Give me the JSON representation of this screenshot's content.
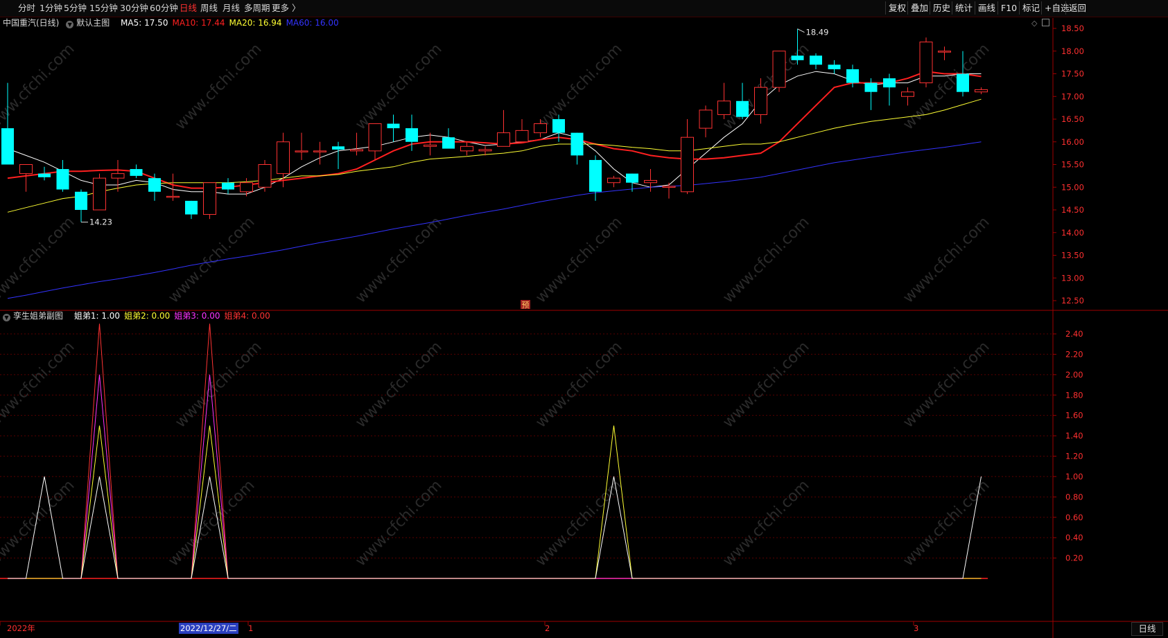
{
  "toolbar": {
    "periods": [
      "分时",
      "1分钟",
      "5分钟",
      "15分钟",
      "30分钟",
      "60分钟",
      "日线",
      "周线",
      "月线",
      "多周期",
      "更多 〉"
    ],
    "active": "日线",
    "right_buttons": [
      "复权",
      "叠加",
      "历史",
      "统计",
      "画线",
      "F10",
      "标记",
      "+自选",
      "返回"
    ]
  },
  "main_panel": {
    "title": "中国重汽(日线)",
    "template": "默认主图",
    "ma": [
      {
        "label": "MA5: 17.50",
        "color": "#ffffff"
      },
      {
        "label": "MA10: 17.44",
        "color": "#ff2020"
      },
      {
        "label": "MA20: 16.94",
        "color": "#ffff33"
      },
      {
        "label": "MA60: 16.00",
        "color": "#3333ff"
      }
    ],
    "high_label": "18.49",
    "low_label": "14.23",
    "pre_marker": "预",
    "y_ticks": [
      "18.50",
      "18.00",
      "17.50",
      "17.00",
      "16.50",
      "16.00",
      "15.50",
      "15.00",
      "14.50",
      "14.00",
      "13.50",
      "13.00",
      "12.50"
    ]
  },
  "sub_panel": {
    "title": "孪生姐弟副图",
    "lines": [
      {
        "label": "姐弟1: 1.00",
        "color": "#ffffff"
      },
      {
        "label": "姐弟2: 0.00",
        "color": "#ffff33"
      },
      {
        "label": "姐弟3: 0.00",
        "color": "#ff33ff"
      },
      {
        "label": "姐弟4: 0.00",
        "color": "#ff3333"
      }
    ],
    "y_ticks": [
      "2.40",
      "2.20",
      "2.00",
      "1.80",
      "1.60",
      "1.40",
      "1.20",
      "1.00",
      "0.80",
      "0.60",
      "0.40",
      "0.20"
    ]
  },
  "bottom_axis": {
    "start": "2022年",
    "cursor_date": "2022/12/27/二",
    "month_1": "1",
    "month_2": "2",
    "month_3": "3",
    "mode_button": "日线"
  },
  "watermark": "www.cfchi.com",
  "chart_data": [
    {
      "type": "candlestick",
      "title": "中国重汽(日线)",
      "ylim": [
        12.4,
        18.6
      ],
      "candles": [
        [
          16.3,
          17.3,
          15.5,
          15.5
        ],
        [
          15.3,
          15.5,
          14.9,
          15.5
        ],
        [
          15.3,
          15.45,
          15.15,
          15.22
        ],
        [
          15.4,
          15.6,
          14.9,
          14.95
        ],
        [
          14.9,
          14.95,
          14.23,
          14.5
        ],
        [
          14.5,
          15.3,
          14.5,
          15.2
        ],
        [
          15.2,
          15.6,
          14.9,
          15.3
        ],
        [
          15.4,
          15.5,
          15.2,
          15.25
        ],
        [
          15.2,
          15.3,
          14.7,
          14.9
        ],
        [
          14.8,
          15.3,
          14.7,
          14.8
        ],
        [
          14.7,
          14.7,
          14.3,
          14.4
        ],
        [
          14.4,
          15.1,
          14.3,
          15.1
        ],
        [
          15.1,
          15.2,
          14.85,
          14.95
        ],
        [
          14.9,
          15.2,
          14.8,
          15.1
        ],
        [
          15.0,
          15.6,
          14.9,
          15.5
        ],
        [
          15.3,
          16.2,
          15.0,
          16.0
        ],
        [
          15.8,
          16.2,
          15.6,
          15.8
        ],
        [
          15.8,
          16.0,
          15.5,
          15.8
        ],
        [
          15.9,
          16.0,
          15.4,
          15.83
        ],
        [
          15.8,
          16.2,
          15.7,
          15.83
        ],
        [
          15.8,
          16.4,
          15.6,
          16.4
        ],
        [
          16.4,
          16.6,
          16.0,
          16.3
        ],
        [
          16.3,
          16.6,
          15.8,
          16.0
        ],
        [
          15.9,
          16.2,
          15.7,
          15.93
        ],
        [
          16.1,
          16.3,
          15.9,
          15.85
        ],
        [
          15.8,
          16.0,
          15.7,
          15.9
        ],
        [
          15.8,
          15.9,
          15.7,
          15.83
        ],
        [
          15.9,
          16.7,
          15.9,
          16.2
        ],
        [
          16.0,
          16.5,
          16.0,
          16.25
        ],
        [
          16.2,
          16.5,
          16.1,
          16.4
        ],
        [
          16.5,
          16.6,
          16.0,
          16.2
        ],
        [
          16.2,
          16.2,
          15.5,
          15.7
        ],
        [
          15.6,
          15.7,
          14.7,
          14.9
        ],
        [
          15.1,
          15.25,
          15.0,
          15.2
        ],
        [
          15.3,
          15.3,
          14.9,
          15.1
        ],
        [
          15.1,
          15.4,
          14.9,
          15.15
        ],
        [
          15.0,
          15.1,
          14.75,
          15.02
        ],
        [
          14.9,
          16.5,
          14.85,
          16.1
        ],
        [
          16.3,
          16.8,
          16.1,
          16.7
        ],
        [
          16.6,
          17.3,
          16.5,
          16.9
        ],
        [
          16.9,
          17.3,
          16.5,
          16.55
        ],
        [
          16.6,
          17.4,
          16.4,
          17.2
        ],
        [
          17.2,
          18.0,
          17.1,
          18.0
        ],
        [
          17.9,
          18.49,
          17.7,
          17.8
        ],
        [
          17.9,
          17.95,
          17.6,
          17.7
        ],
        [
          17.7,
          17.8,
          17.5,
          17.6
        ],
        [
          17.6,
          17.7,
          17.2,
          17.3
        ],
        [
          17.3,
          17.4,
          16.7,
          17.1
        ],
        [
          17.4,
          17.5,
          16.8,
          17.2
        ],
        [
          17.0,
          17.2,
          16.8,
          17.1
        ],
        [
          17.3,
          18.3,
          17.2,
          18.2
        ],
        [
          18.0,
          18.1,
          17.8,
          18.0
        ],
        [
          17.5,
          18.0,
          17.0,
          17.1
        ],
        [
          17.1,
          17.2,
          17.05,
          17.15
        ]
      ],
      "series": [
        {
          "name": "MA5",
          "values": [
            15.85,
            15.7,
            15.55,
            15.35,
            15.15,
            15.05,
            15.05,
            15.15,
            15.1,
            14.95,
            14.9,
            14.9,
            14.85,
            14.85,
            15.0,
            15.2,
            15.45,
            15.65,
            15.8,
            15.85,
            15.9,
            16.0,
            16.1,
            16.15,
            16.1,
            16.0,
            15.92,
            15.95,
            16.0,
            16.05,
            16.2,
            16.1,
            15.8,
            15.4,
            15.1,
            15.0,
            15.05,
            15.4,
            15.75,
            16.1,
            16.4,
            16.9,
            17.25,
            17.45,
            17.55,
            17.5,
            17.35,
            17.25,
            17.3,
            17.3,
            17.45,
            17.45,
            17.5,
            17.5
          ]
        },
        {
          "name": "MA10",
          "values": [
            15.2,
            15.25,
            15.3,
            15.35,
            15.35,
            15.37,
            15.38,
            15.35,
            15.2,
            15.05,
            14.98,
            14.98,
            15.0,
            15.05,
            15.1,
            15.15,
            15.2,
            15.25,
            15.3,
            15.4,
            15.6,
            15.8,
            15.95,
            16.0,
            16.0,
            16.0,
            15.98,
            15.95,
            15.98,
            16.05,
            16.1,
            16.05,
            15.95,
            15.85,
            15.8,
            15.7,
            15.65,
            15.62,
            15.62,
            15.65,
            15.7,
            15.75,
            16.0,
            16.4,
            16.8,
            17.2,
            17.3,
            17.3,
            17.3,
            17.4,
            17.55,
            17.5,
            17.5,
            17.44
          ]
        },
        {
          "name": "MA20",
          "values": [
            14.45,
            14.55,
            14.65,
            14.75,
            14.8,
            14.9,
            14.98,
            15.05,
            15.08,
            15.1,
            15.1,
            15.1,
            15.1,
            15.12,
            15.15,
            15.2,
            15.25,
            15.25,
            15.28,
            15.35,
            15.4,
            15.45,
            15.55,
            15.62,
            15.65,
            15.68,
            15.72,
            15.75,
            15.8,
            15.9,
            15.95,
            15.95,
            15.95,
            15.92,
            15.88,
            15.85,
            15.8,
            15.8,
            15.85,
            15.9,
            15.95,
            15.95,
            16.0,
            16.1,
            16.2,
            16.3,
            16.38,
            16.45,
            16.5,
            16.55,
            16.6,
            16.7,
            16.82,
            16.94
          ]
        },
        {
          "name": "MA60",
          "values": [
            12.55,
            12.62,
            12.7,
            12.78,
            12.85,
            12.92,
            12.98,
            13.05,
            13.12,
            13.2,
            13.28,
            13.35,
            13.42,
            13.48,
            13.55,
            13.62,
            13.7,
            13.78,
            13.85,
            13.92,
            14.0,
            14.08,
            14.15,
            14.22,
            14.3,
            14.38,
            14.45,
            14.52,
            14.6,
            14.68,
            14.75,
            14.82,
            14.88,
            14.92,
            14.96,
            15.0,
            15.02,
            15.04,
            15.08,
            15.12,
            15.17,
            15.22,
            15.3,
            15.38,
            15.46,
            15.54,
            15.6,
            15.66,
            15.72,
            15.78,
            15.83,
            15.88,
            15.94,
            16.0
          ]
        }
      ]
    },
    {
      "type": "line",
      "title": "孪生姐弟副图",
      "ylim": [
        0,
        2.6
      ],
      "series": [
        {
          "name": "姐弟1",
          "color": "#ffffff",
          "values": [
            0,
            0,
            1,
            0,
            0,
            1,
            0,
            0,
            0,
            0,
            0,
            1,
            0,
            0,
            0,
            0,
            0,
            0,
            0,
            0,
            0,
            0,
            0,
            0,
            0,
            0,
            0,
            0,
            0,
            0,
            0,
            0,
            0,
            1,
            0,
            0,
            0,
            0,
            0,
            0,
            0,
            0,
            0,
            0,
            0,
            0,
            0,
            0,
            0,
            0,
            0,
            0,
            0,
            1
          ]
        },
        {
          "name": "姐弟2",
          "color": "#ffff33",
          "values": [
            0,
            0,
            0,
            0,
            0,
            1.5,
            0,
            0,
            0,
            0,
            0,
            1.5,
            0,
            0,
            0,
            0,
            0,
            0,
            0,
            0,
            0,
            0,
            0,
            0,
            0,
            0,
            0,
            0,
            0,
            0,
            0,
            0,
            0,
            1.5,
            0,
            0,
            0,
            0,
            0,
            0,
            0,
            0,
            0,
            0,
            0,
            0,
            0,
            0,
            0,
            0,
            0,
            0,
            0,
            0
          ]
        },
        {
          "name": "姐弟3",
          "color": "#ff33ff",
          "values": [
            0,
            0,
            0,
            0,
            0,
            2,
            0,
            0,
            0,
            0,
            0,
            2,
            0,
            0,
            0,
            0,
            0,
            0,
            0,
            0,
            0,
            0,
            0,
            0,
            0,
            0,
            0,
            0,
            0,
            0,
            0,
            0,
            0,
            0,
            0,
            0,
            0,
            0,
            0,
            0,
            0,
            0,
            0,
            0,
            0,
            0,
            0,
            0,
            0,
            0,
            0,
            0,
            0,
            0
          ]
        },
        {
          "name": "姐弟4",
          "color": "#ff3333",
          "values": [
            0,
            0,
            0,
            0,
            0,
            2.5,
            0,
            0,
            0,
            0,
            0,
            2.5,
            0,
            0,
            0,
            0,
            0,
            0,
            0,
            0,
            0,
            0,
            0,
            0,
            0,
            0,
            0,
            0,
            0,
            0,
            0,
            0,
            0,
            0,
            0,
            0,
            0,
            0,
            0,
            0,
            0,
            0,
            0,
            0,
            0,
            0,
            0,
            0,
            0,
            0,
            0,
            0,
            0,
            0
          ]
        }
      ]
    }
  ]
}
